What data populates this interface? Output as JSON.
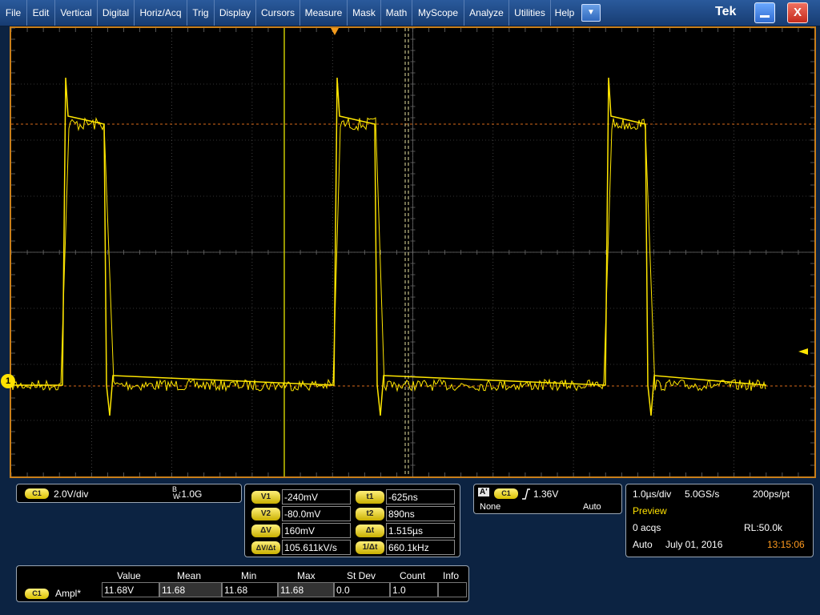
{
  "menu": {
    "items": [
      "File",
      "Edit",
      "Vertical",
      "Digital",
      "Horiz/Acq",
      "Trig",
      "Display",
      "Cursors",
      "Measure",
      "Mask",
      "Math",
      "MyScope",
      "Analyze",
      "Utilities",
      "Help"
    ],
    "dropdown_icon": "chevron-down-icon",
    "logo": "Tek",
    "close_label": "X"
  },
  "graticule": {
    "channel_marker": "1",
    "colors": {
      "trace": "#ffe600",
      "grid": "#6a6a6a",
      "cursor_h": "#d96a1a",
      "cursor_v": "#e6e0a0",
      "border": "#c97f1a"
    }
  },
  "channel": {
    "badge": "C1",
    "scale": "2.0V/div",
    "bw_label": "B",
    "bw_sub": "W",
    "bw_value": ":1.0G"
  },
  "cursors": {
    "v1_label": "V1",
    "v1_value": "-240mV",
    "v2_label": "V2",
    "v2_value": "-80.0mV",
    "dv_label": "ΔV",
    "dv_value": "160mV",
    "dvdt_label": "ΔV/Δt",
    "dvdt_value": "105.611kV/s",
    "t1_label": "t1",
    "t1_value": "-625ns",
    "t2_label": "t2",
    "t2_value": "890ns",
    "dt_label": "Δt",
    "dt_value": "1.515µs",
    "inv_dt_label": "1/Δt",
    "inv_dt_value": "660.1kHz"
  },
  "trigger": {
    "label": "A'",
    "source": "C1",
    "level": "1.36V",
    "coupling": "None",
    "mode": "Auto"
  },
  "acquisition": {
    "time_div": "1.0µs/div",
    "sample_rate": "5.0GS/s",
    "resolution": "200ps/pt",
    "status": "Preview",
    "acqs": "0 acqs",
    "record_length": "RL:50.0k",
    "mode": "Auto",
    "date": "July 01, 2016",
    "time": "13:15:06"
  },
  "measurements": {
    "headers": [
      "Value",
      "Mean",
      "Min",
      "Max",
      "St Dev",
      "Count",
      "Info"
    ],
    "rows": [
      {
        "source": "C1",
        "name": "Ampl*",
        "value": "11.68V",
        "mean": "11.68",
        "min": "11.68",
        "max": "11.68",
        "stdev": "0.0",
        "count": "1.0",
        "info": ""
      }
    ]
  }
}
